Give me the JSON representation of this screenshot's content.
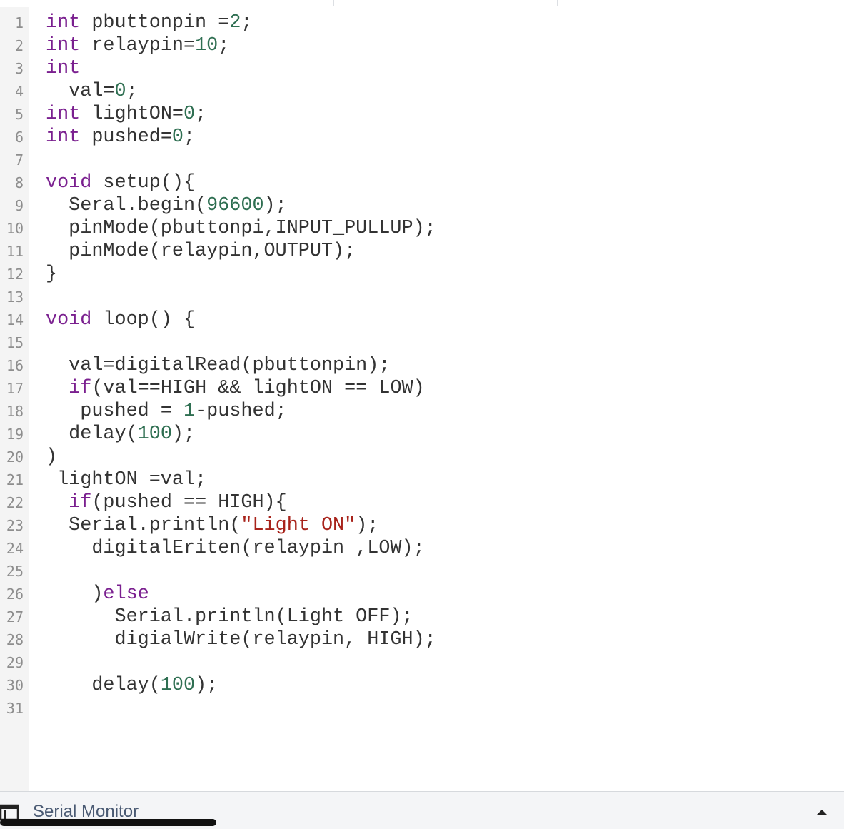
{
  "editor": {
    "lines": [
      [
        [
          "kw",
          "int"
        ],
        [
          "p",
          " pbuttonpin ="
        ],
        [
          "n",
          "2"
        ],
        [
          "p",
          ";"
        ]
      ],
      [
        [
          "kw",
          "int"
        ],
        [
          "p",
          " relaypin="
        ],
        [
          "n",
          "10"
        ],
        [
          "p",
          ";"
        ]
      ],
      [
        [
          "kw",
          "int"
        ]
      ],
      [
        [
          "p",
          "  val="
        ],
        [
          "n",
          "0"
        ],
        [
          "p",
          ";"
        ]
      ],
      [
        [
          "kw",
          "int"
        ],
        [
          "p",
          " lightON="
        ],
        [
          "n",
          "0"
        ],
        [
          "p",
          ";"
        ]
      ],
      [
        [
          "kw",
          "int"
        ],
        [
          "p",
          " pushed="
        ],
        [
          "n",
          "0"
        ],
        [
          "p",
          ";"
        ]
      ],
      [],
      [
        [
          "kw",
          "void"
        ],
        [
          "p",
          " setup(){"
        ]
      ],
      [
        [
          "p",
          "  Seral.begin("
        ],
        [
          "n",
          "96600"
        ],
        [
          "p",
          ");"
        ]
      ],
      [
        [
          "p",
          "  pinMode(pbuttonpi,INPUT_PULLUP);"
        ]
      ],
      [
        [
          "p",
          "  pinMode(relaypin,OUTPUT);"
        ]
      ],
      [
        [
          "p",
          "}"
        ]
      ],
      [],
      [
        [
          "kw",
          "void"
        ],
        [
          "p",
          " loop() {"
        ]
      ],
      [],
      [
        [
          "p",
          "  val=digitalRead(pbuttonpin);"
        ]
      ],
      [
        [
          "p",
          "  "
        ],
        [
          "kw",
          "if"
        ],
        [
          "p",
          "(val==HIGH && lightON == LOW)"
        ]
      ],
      [
        [
          "p",
          "   pushed = "
        ],
        [
          "n",
          "1"
        ],
        [
          "p",
          "-pushed;"
        ]
      ],
      [
        [
          "p",
          "  delay("
        ],
        [
          "n",
          "100"
        ],
        [
          "p",
          ");"
        ]
      ],
      [
        [
          "p",
          ")"
        ]
      ],
      [
        [
          "p",
          " lightON =val;"
        ]
      ],
      [
        [
          "p",
          "  "
        ],
        [
          "kw",
          "if"
        ],
        [
          "p",
          "(pushed == HIGH){"
        ]
      ],
      [
        [
          "p",
          "  Serial.println("
        ],
        [
          "s",
          "\"Light ON\""
        ],
        [
          "p",
          ");"
        ]
      ],
      [
        [
          "p",
          "    digitalEriten(relaypin ,LOW);"
        ]
      ],
      [],
      [
        [
          "p",
          "    )"
        ],
        [
          "kw",
          "else"
        ]
      ],
      [
        [
          "p",
          "      Serial.println(Light OFF);"
        ]
      ],
      [
        [
          "p",
          "      digialWrite(relaypin, HIGH);"
        ]
      ],
      [],
      [
        [
          "p",
          "    delay("
        ],
        [
          "n",
          "100"
        ],
        [
          "p",
          ");"
        ]
      ],
      []
    ]
  },
  "bottom_panel": {
    "label": "Serial Monitor",
    "icon": "serial-monitor-icon",
    "toggle_icon": "caret-up-icon"
  },
  "colors": {
    "keyword": "#7a1f8f",
    "number": "#2f6f52",
    "string": "#a8231b",
    "plain": "#333333"
  }
}
